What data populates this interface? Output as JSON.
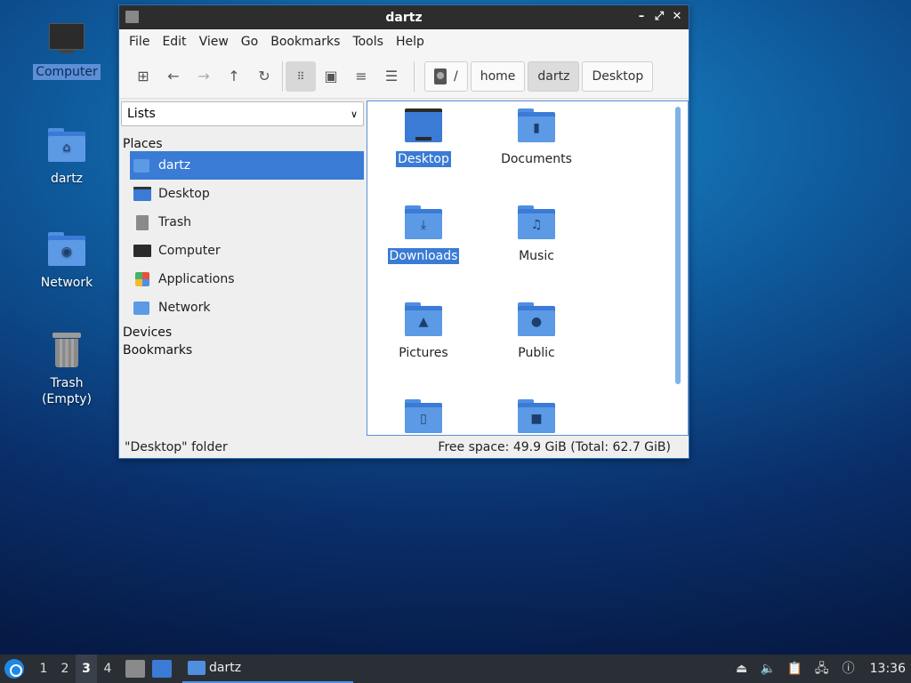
{
  "desktop": {
    "icons": [
      {
        "label": "Computer"
      },
      {
        "label": "dartz"
      },
      {
        "label": "Network"
      },
      {
        "label": "Trash (Empty)"
      }
    ]
  },
  "window": {
    "title": "dartz",
    "menu": [
      "File",
      "Edit",
      "View",
      "Go",
      "Bookmarks",
      "Tools",
      "Help"
    ],
    "breadcrumbs": [
      "/",
      "home",
      "dartz",
      "Desktop"
    ],
    "side_combo": "Lists",
    "sections": {
      "places": "Places",
      "devices": "Devices",
      "bookmarks": "Bookmarks"
    },
    "places": [
      "dartz",
      "Desktop",
      "Trash",
      "Computer",
      "Applications",
      "Network"
    ],
    "files": [
      {
        "label": "Desktop",
        "icon": "desktop-folder-icon"
      },
      {
        "label": "Documents",
        "icon": "documents-folder-icon"
      },
      {
        "label": "Downloads",
        "icon": "downloads-folder-icon"
      },
      {
        "label": "Music",
        "icon": "music-folder-icon"
      },
      {
        "label": "Pictures",
        "icon": "pictures-folder-icon"
      },
      {
        "label": "Public",
        "icon": "public-folder-icon"
      },
      {
        "label": "",
        "icon": "templates-folder-icon"
      },
      {
        "label": "",
        "icon": "videos-folder-icon"
      }
    ],
    "status_left": "\"Desktop\" folder",
    "status_right": "Free space: 49.9 GiB (Total: 62.7 GiB)"
  },
  "taskbar": {
    "workspaces": [
      "1",
      "2",
      "3",
      "4"
    ],
    "task_label": "dartz",
    "clock": "13:36"
  },
  "colors": {
    "accent": "#3a7bd5",
    "folder": "#5c9ae6",
    "taskbar": "#2a2f36"
  }
}
